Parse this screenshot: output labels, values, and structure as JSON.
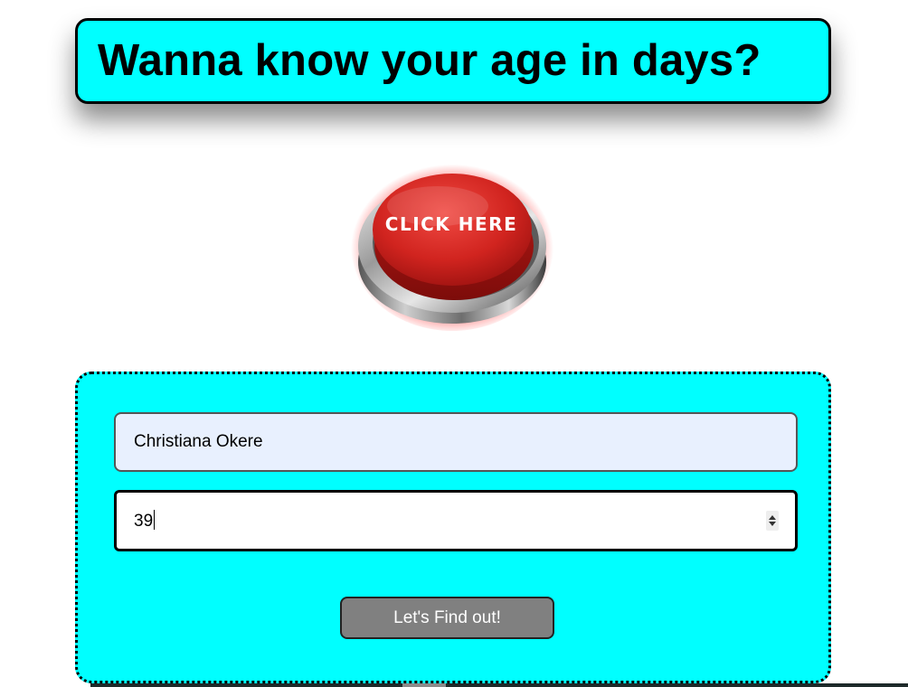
{
  "header": {
    "title": "Wanna know your age in days?"
  },
  "click_button": {
    "label": "CLICK HERE"
  },
  "form": {
    "name_value": "Christiana Okere",
    "age_value": "39",
    "submit_label": "Let's Find out!"
  },
  "colors": {
    "panel_bg": "#00ffff",
    "name_field_bg": "#e8f0fe",
    "submit_bg": "#808080",
    "button_red": "#d62828"
  }
}
